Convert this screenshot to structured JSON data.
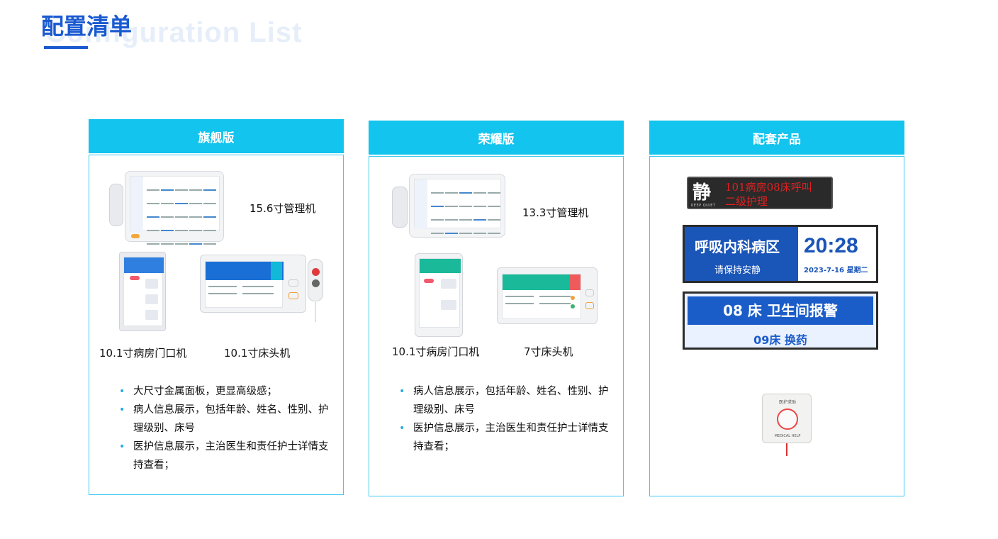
{
  "page": {
    "title": "配置清单",
    "title_shadow": "Configuration List"
  },
  "columns": [
    {
      "header": "旗舰版",
      "devices": {
        "manager": "15.6寸管理机",
        "door": "10.1寸病房门口机",
        "bed": "10.1寸床头机"
      },
      "features": [
        "大尺寸金属面板，更显高级感；",
        "病人信息展示，包括年龄、姓名、性别、护理级别、床号",
        "医护信息展示，主治医生和责任护士详情支持查看；"
      ]
    },
    {
      "header": "荣耀版",
      "devices": {
        "manager": "13.3寸管理机",
        "door": "10.1寸病房门口机",
        "bed": "7寸床头机"
      },
      "features": [
        "病人信息展示，包括年龄、姓名、性别、护理级别、床号",
        "医护信息展示，主治医生和责任护士详情支持查看；"
      ]
    },
    {
      "header": "配套产品",
      "led": {
        "char": "静",
        "sub": "KEEP QUIET",
        "line1": "101病房08床呼叫",
        "line2": "二级护理"
      },
      "corridor": {
        "ward": "呼吸内科病区",
        "hint": "请保持安静",
        "time": "20:28",
        "date": "2023-7-16  星期二"
      },
      "alarm": {
        "line1": "08 床  卫生间报警",
        "line2": "09床  换药"
      },
      "button": {
        "top": "医护求助",
        "bottom": "MEDICAL HELP"
      }
    }
  ],
  "colors": {
    "title": "#1a5ad0",
    "header": "#12c4ee",
    "border": "#3ec8ef",
    "accent_blue": "#1a55b8"
  }
}
